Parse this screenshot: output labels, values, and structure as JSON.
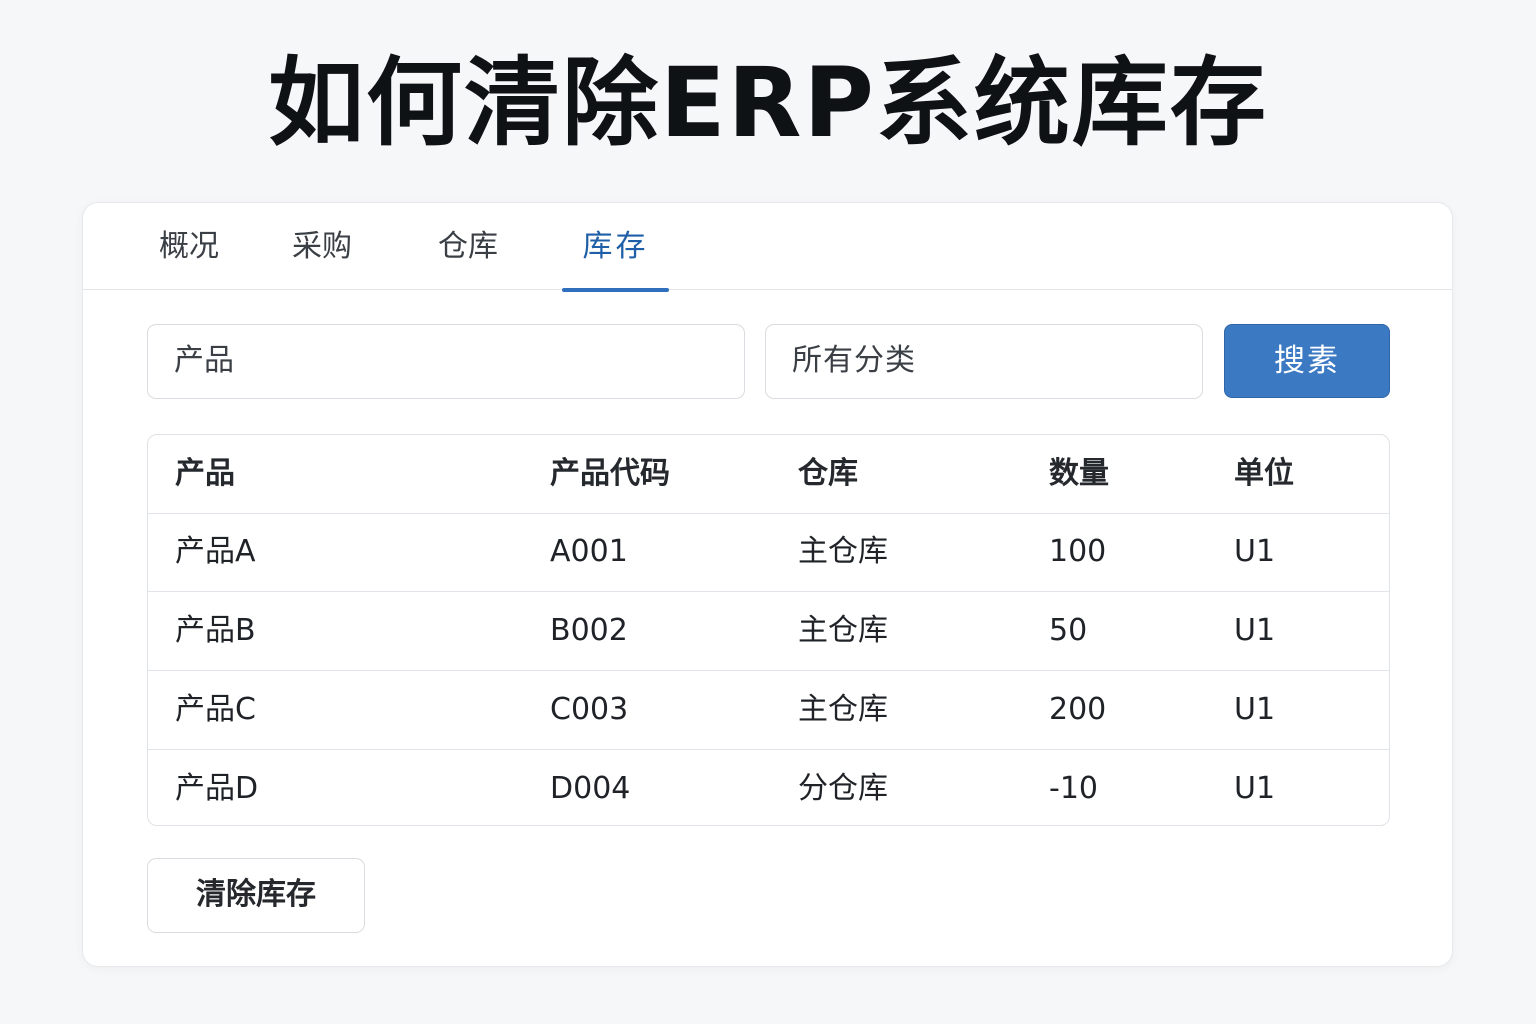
{
  "page": {
    "title": "如何清除ERP系统库存"
  },
  "tabs": [
    {
      "label": "概况"
    },
    {
      "label": "采购"
    },
    {
      "label": "仓库"
    },
    {
      "label": "库存"
    }
  ],
  "active_tab": "库存",
  "filters": {
    "product_placeholder": "产品",
    "category_value": "所有分类",
    "search_label": "搜素"
  },
  "table": {
    "headers": [
      "产品",
      "产品代码",
      "仓库",
      "数量",
      "单位"
    ],
    "rows": [
      [
        "产品A",
        "A001",
        "主仓库",
        "100",
        "U1"
      ],
      [
        "产品B",
        "B002",
        "主仓库",
        "50",
        "U1"
      ],
      [
        "产品C",
        "C003",
        "主仓库",
        "200",
        "U1"
      ],
      [
        "产品D",
        "D004",
        "分仓库",
        "-10",
        "U1"
      ]
    ]
  },
  "actions": {
    "clear_label": "清除库存"
  },
  "colors": {
    "accent": "#3b79c3",
    "active_tab": "#1f5fa8"
  }
}
